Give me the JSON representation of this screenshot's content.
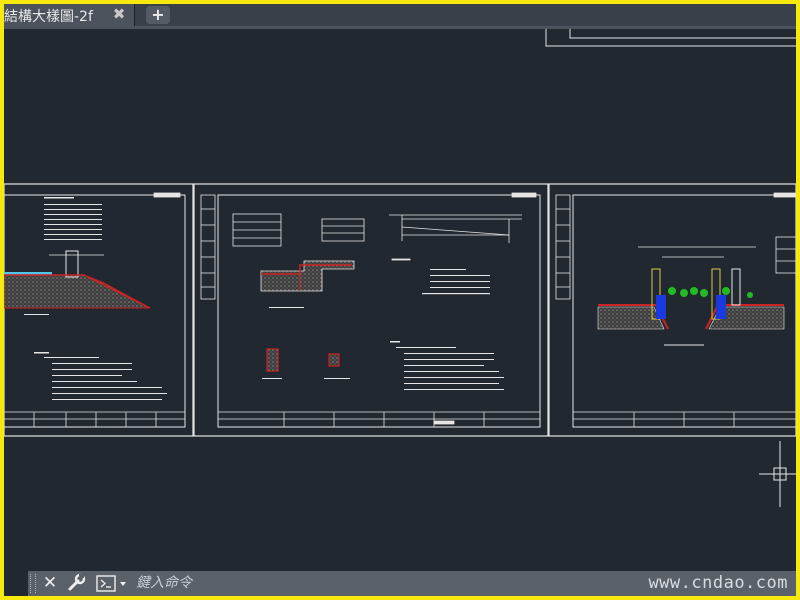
{
  "window": {
    "tab_title": "結構大樣圖-2f",
    "tab_close_glyph": "✖",
    "new_tab_glyph": "+"
  },
  "command_line": {
    "close_glyph": "✕",
    "prompt_placeholder": "鍵入命令"
  },
  "watermark": "www.cndao.com",
  "colors": {
    "frame_border": "#f7e90e",
    "model_space_bg": "#212830",
    "linework": "#e6e6e6",
    "section_red": "#cc2222",
    "hatch_grey": "#5a5a5a",
    "water_cyan": "#4fc7e6",
    "planting_green": "#22bb22",
    "curb_blue": "#1a3adf",
    "tree_yellow": "#d9c94a"
  }
}
